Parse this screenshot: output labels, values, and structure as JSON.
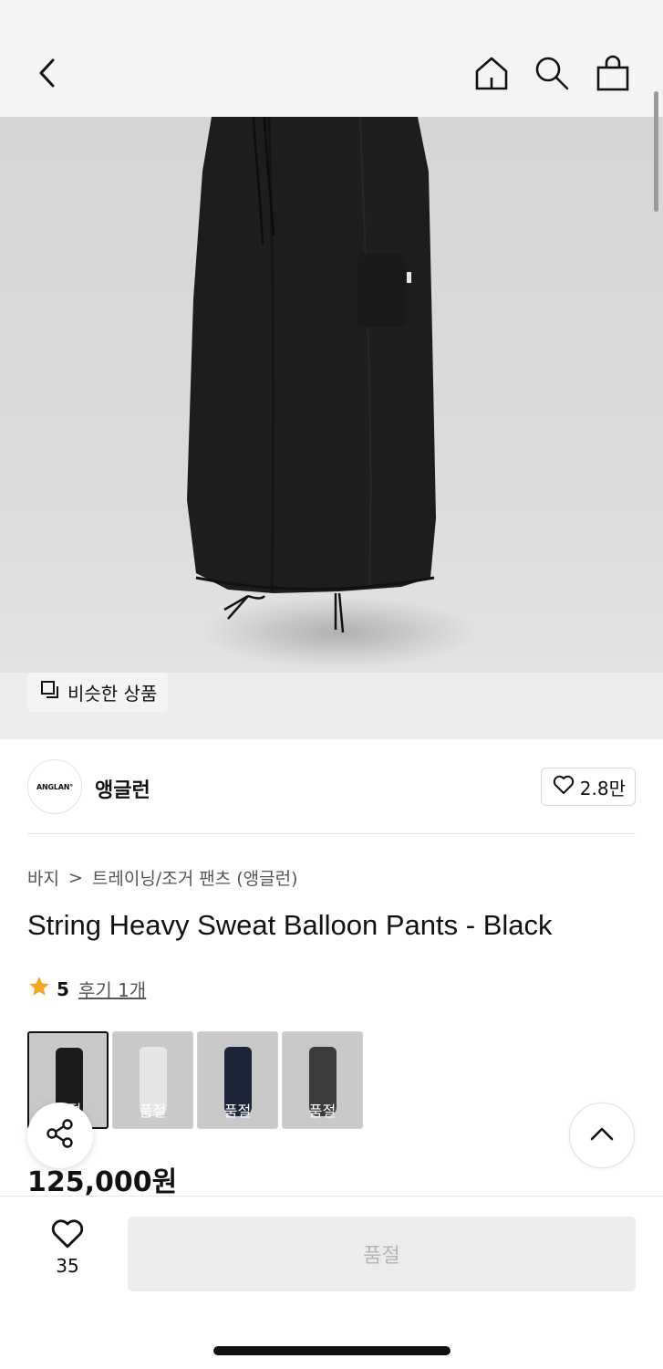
{
  "header": {
    "icons": [
      "back-chevron-icon",
      "home-icon",
      "search-icon",
      "shopping-bag-icon"
    ]
  },
  "product_image": {
    "similar_button_label": "비슷한 상품"
  },
  "brand": {
    "logo_text": "ANGLAN°",
    "name": "앵글런",
    "like_count": "2.8만"
  },
  "breadcrumb": {
    "category": "바지",
    "separator": ">",
    "subcategory": "트레이닝/조거 팬츠 (앵글런)"
  },
  "product": {
    "title": "String Heavy Sweat Balloon Pants - Black",
    "rating": "5",
    "reviews_label": "후기 1개",
    "price": "125,000원"
  },
  "swatches": [
    {
      "color": "#1a1a1a",
      "label": "품절",
      "active": true
    },
    {
      "color": "#e6e6e6",
      "label": "품절",
      "active": false
    },
    {
      "color": "#1c2438",
      "label": "품절",
      "active": false
    },
    {
      "color": "#3c3c3c",
      "label": "품절",
      "active": false
    }
  ],
  "bottom_bar": {
    "wish_count": "35",
    "buy_label": "품절"
  },
  "colors": {
    "star": "#f5a623",
    "sold_out_button_bg": "#ececec",
    "sold_out_button_text": "#b5b5b5"
  }
}
